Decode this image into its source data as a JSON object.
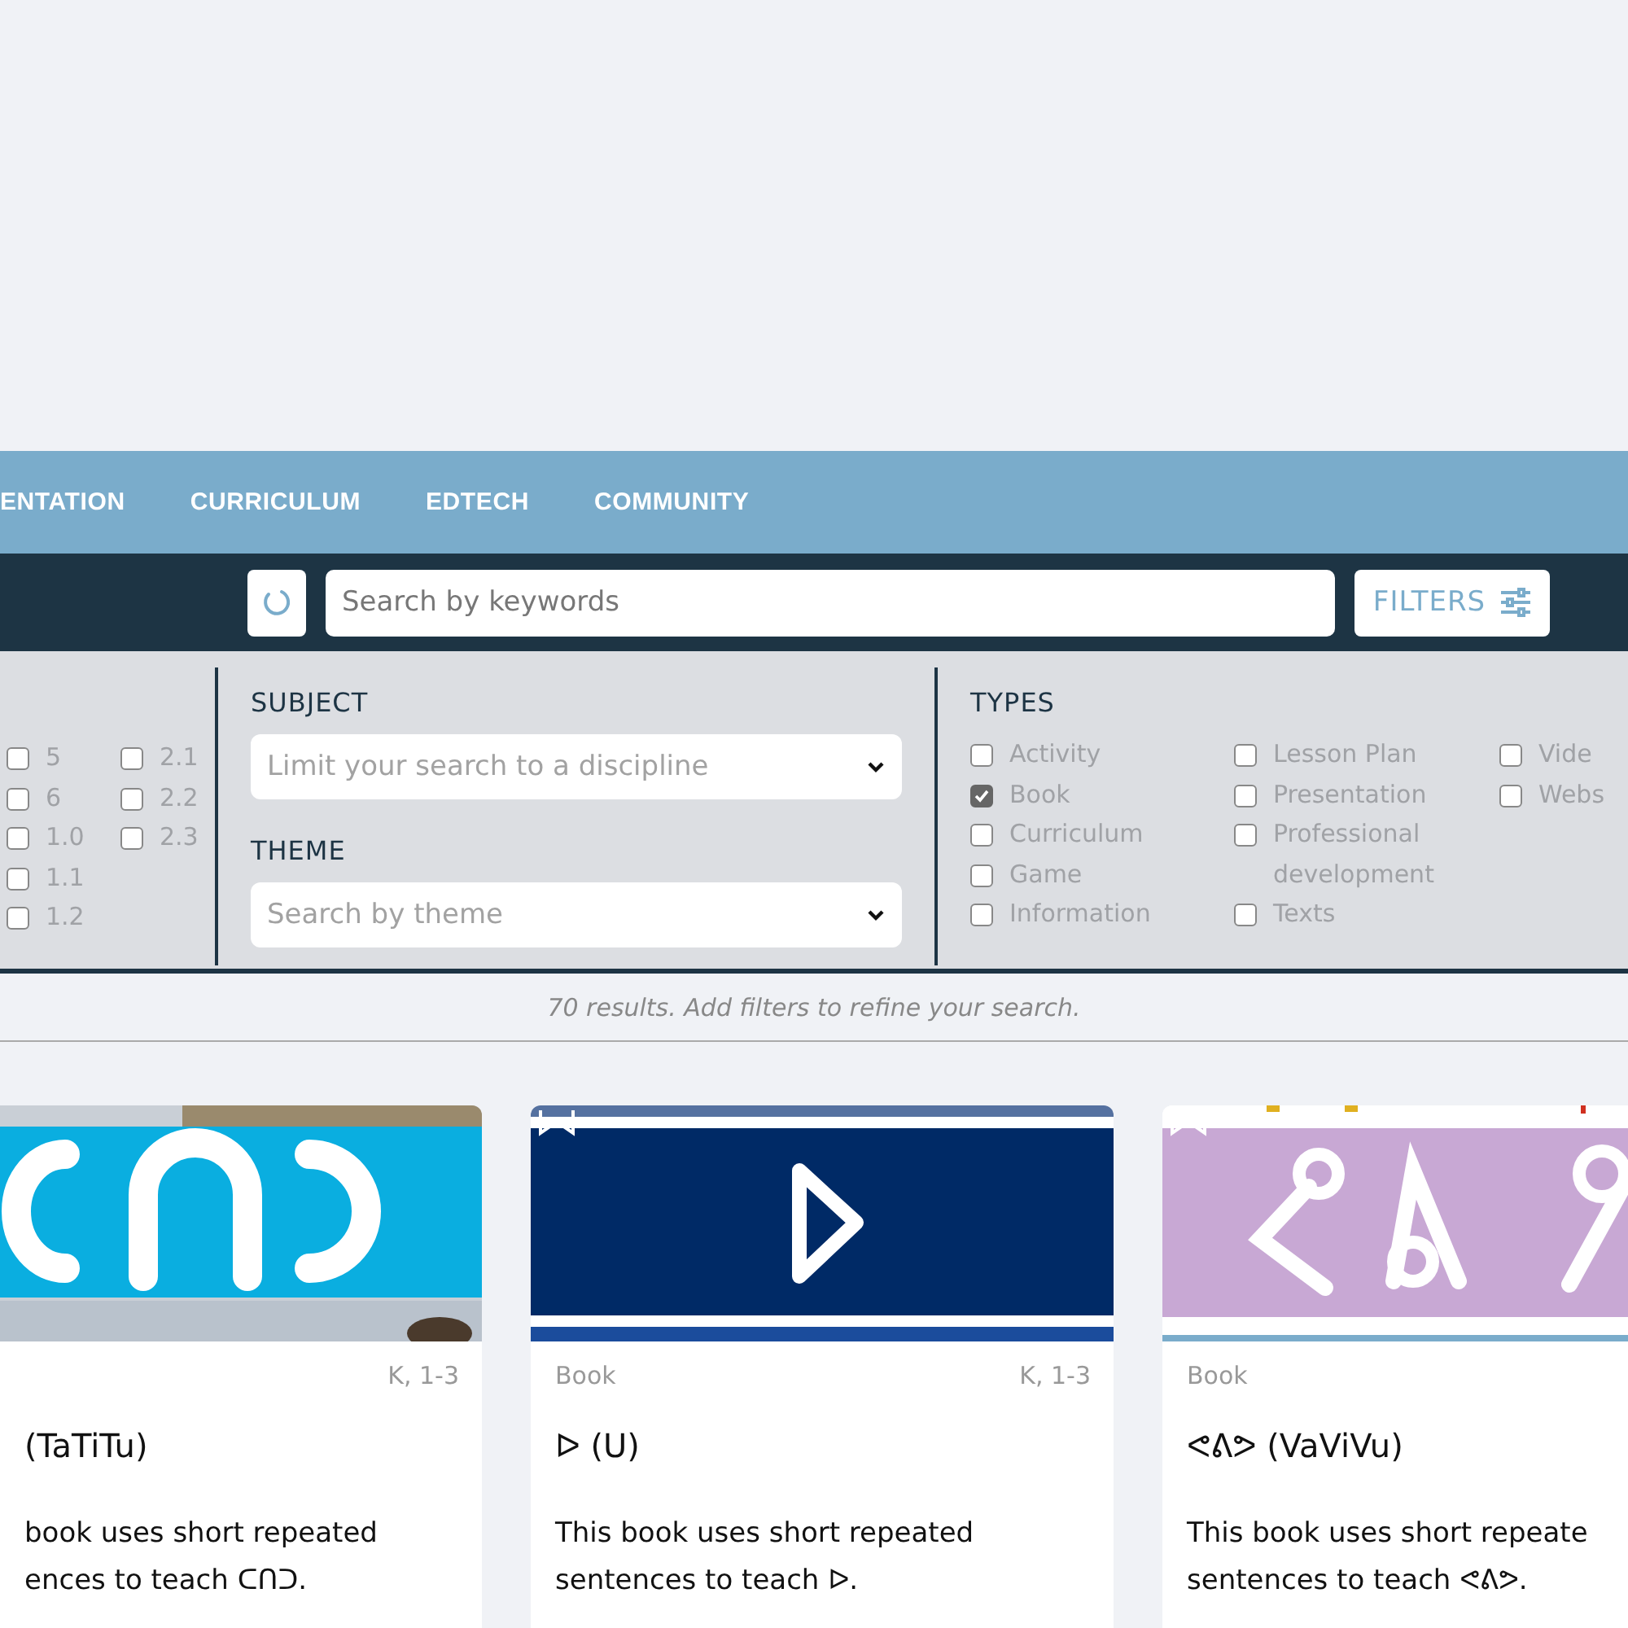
{
  "nav": {
    "items": [
      {
        "label": "ENTATION"
      },
      {
        "label": "CURRICULUM"
      },
      {
        "label": "EDTECH"
      },
      {
        "label": "COMMUNITY"
      }
    ]
  },
  "search": {
    "placeholder": "Search by keywords",
    "filters_button": "FILTERS"
  },
  "grades": {
    "columns": [
      [
        {
          "label": "5",
          "checked": false
        },
        {
          "label": "6",
          "checked": false
        },
        {
          "label": "1.0",
          "checked": false
        },
        {
          "label": "1.1",
          "checked": false
        },
        {
          "label": "1.2",
          "checked": false
        }
      ],
      [
        {
          "label": "2.1",
          "checked": false
        },
        {
          "label": "2.2",
          "checked": false
        },
        {
          "label": "2.3",
          "checked": false
        }
      ]
    ]
  },
  "subject": {
    "label": "SUBJECT",
    "placeholder": "Limit your search to a discipline"
  },
  "theme": {
    "label": "THEME",
    "placeholder": "Search by theme"
  },
  "types": {
    "label": "TYPES",
    "columns": [
      [
        {
          "label": "Activity",
          "checked": false
        },
        {
          "label": "Book",
          "checked": true
        },
        {
          "label": "Curriculum",
          "checked": false
        },
        {
          "label": "Game",
          "checked": false
        },
        {
          "label": "Information",
          "checked": false
        }
      ],
      [
        {
          "label": "Lesson Plan",
          "checked": false
        },
        {
          "label": "Presentation",
          "checked": false
        },
        {
          "label": "Professional development",
          "checked": false
        },
        {
          "label": "Texts",
          "checked": false
        }
      ],
      [
        {
          "label": "Vide",
          "checked": false
        },
        {
          "label": "Webs",
          "checked": false
        }
      ]
    ]
  },
  "results_text": "70 results. Add filters to refine your search.",
  "cards": [
    {
      "grades": "K, 1-3",
      "title": "(TaTiTu)",
      "description": "book uses short repeated\nences to teach ᑕᑎᑐ."
    },
    {
      "type": "Book",
      "grades": "K, 1-3",
      "title": "ᐅ (U)",
      "description": "This book uses short repeated\nsentences to teach ᐅ."
    },
    {
      "type": "Book",
      "title": "ᕙᕕᕗ (VaViVu)",
      "description": "This book uses short repeate\nsentences to teach ᕙᕕᕗ."
    }
  ]
}
